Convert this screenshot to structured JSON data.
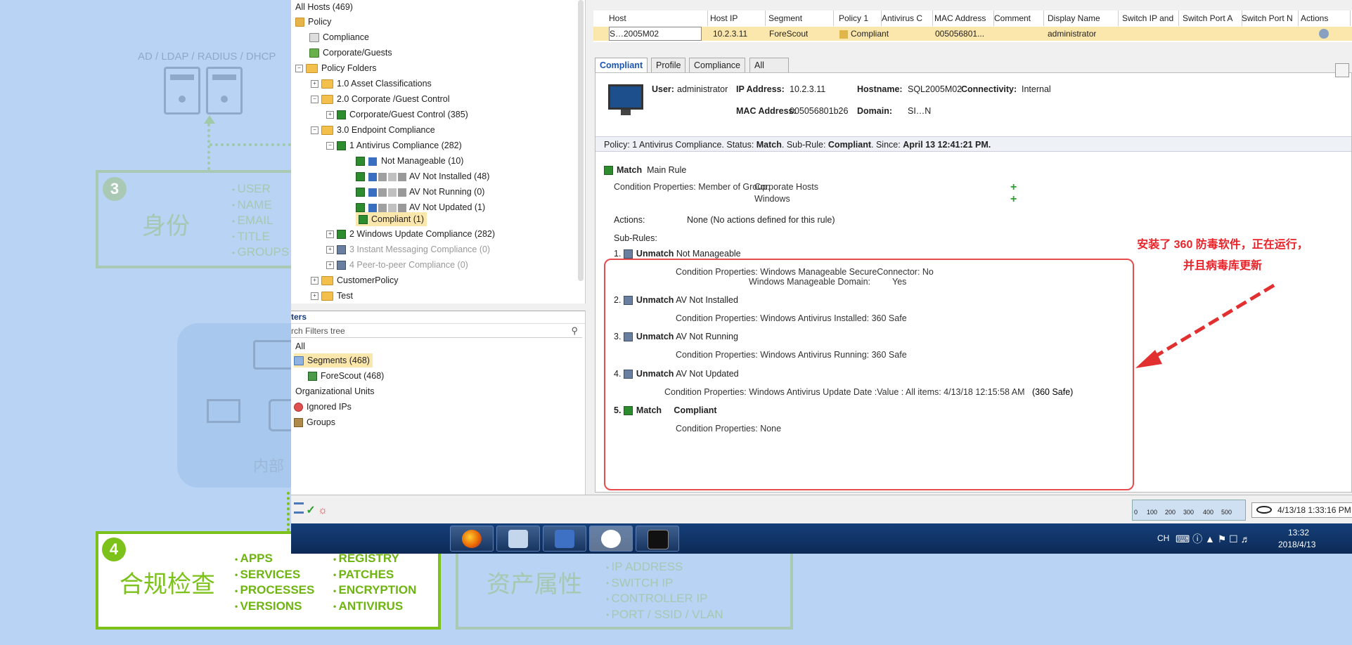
{
  "slide": {
    "ad_label": "AD / LDAP / RADIUS / DHCP",
    "identity": {
      "number": "3",
      "title": "身份",
      "items": [
        "USER",
        "NAME",
        "EMAIL",
        "TITLE",
        "GROUPS"
      ]
    },
    "internal_label": "内部",
    "compliance": {
      "number": "4",
      "title": "合规检查",
      "col1": [
        "APPS",
        "SERVICES",
        "PROCESSES",
        "VERSIONS"
      ],
      "col2": [
        "REGISTRY",
        "PATCHES",
        "ENCRYPTION",
        "ANTIVIRUS"
      ]
    },
    "asset": {
      "title": "资产属性",
      "items": [
        "IP ADDRESS",
        "SWITCH IP",
        "CONTROLLER IP",
        "PORT / SSID / VLAN"
      ]
    }
  },
  "tree": {
    "all_hosts": "All Hosts (469)",
    "policy": "Policy",
    "compliance": "Compliance",
    "corporate_guests": "Corporate/Guests",
    "policy_folders": "Policy Folders",
    "f1": "1.0 Asset Classifications",
    "f2": "2.0 Corporate /Guest Control",
    "f2a": "Corporate/Guest Control (385)",
    "f3": "3.0 Endpoint Compliance",
    "av": "1  Antivirus Compliance (282)",
    "not_manageable": "Not Manageable (10)",
    "not_installed": "AV Not Installed (48)",
    "not_running": "AV Not Running (0)",
    "not_updated": "AV Not Updated (1)",
    "compliant": "Compliant (1)",
    "wu": "2  Windows Update Compliance (282)",
    "im": "3  Instant Messaging Compliance (0)",
    "p2p": "4  Peer-to-peer Compliance (0)",
    "customer": "CustomerPolicy",
    "test": "Test"
  },
  "filters": {
    "header": "ters",
    "search_placeholder": "rch Filters tree",
    "all": "All",
    "segments": "Segments (468)",
    "forescout": "ForeScout (468)",
    "org_units": "Organizational Units",
    "ignored": "Ignored IPs",
    "groups": "Groups"
  },
  "grid": {
    "headers": [
      "Host",
      "Host IP",
      "Segment",
      "Policy 1",
      "Antivirus C",
      "MAC Address",
      "Comment",
      "Display Name",
      "Switch IP and",
      "Switch Port A",
      "Switch Port N",
      "Actions"
    ],
    "row": {
      "host": "S…2005M02",
      "host_ip": "10.2.3.11",
      "segment": "ForeScout",
      "policy": "Compliant",
      "mac": "005056801...",
      "display_name": "administrator"
    }
  },
  "tabs": [
    "Compliant",
    "Profile",
    "Compliance",
    "All policies"
  ],
  "detail": {
    "user_label": "User:",
    "user": "administrator",
    "ip_label": "IP Address:",
    "ip": "10.2.3.11",
    "hostname_label": "Hostname:",
    "hostname": "SQL2005M02",
    "conn_label": "Connectivity:",
    "conn": "Internal",
    "mac_label": "MAC Address:",
    "mac": "005056801b26",
    "domain_label": "Domain:",
    "domain": "SI…N",
    "policy_bar_prefix": "Policy: 1 Antivirus Compliance. Status: ",
    "policy_bar_status": "Match",
    "policy_bar_mid": ". Sub-Rule: ",
    "policy_bar_sub": "Compliant",
    "policy_bar_since": ". Since: ",
    "policy_bar_date": "April 13 12:41:21 PM.",
    "main_match": "Match",
    "main_rule": "Main Rule",
    "cond_label": "Condition Properties: Member of Group:",
    "group1": "Corporate Hosts",
    "group2": "Windows",
    "actions_label": "Actions:",
    "actions_val": "None (No actions defined for this rule)",
    "subrules_label": "Sub-Rules:",
    "sr1_num": "1.",
    "sr1_status": "Unmatch",
    "sr1_name": "Not Manageable",
    "sr1_c1": "Condition Properties: Windows Manageable SecureConnector: No",
    "sr1_c2": "Windows Manageable Domain:",
    "sr1_c2v": "Yes",
    "sr2_num": "2.",
    "sr2_status": "Unmatch",
    "sr2_name": "AV Not Installed",
    "sr2_c": "Condition Properties: Windows Antivirus Installed: 360 Safe",
    "sr3_num": "3.",
    "sr3_status": "Unmatch",
    "sr3_name": "AV Not Running",
    "sr3_c": "Condition Properties: Windows Antivirus Running: 360 Safe",
    "sr4_num": "4.",
    "sr4_status": "Unmatch",
    "sr4_name": "AV Not Updated",
    "sr4_c": "Condition Properties: Windows Antivirus Update Date :Value : All items: 4/13/18 12:15:58 AM",
    "sr4_c_tail": "(360 Safe)",
    "sr5_num": "5.",
    "sr5_status": "Match",
    "sr5_name": "Compliant",
    "sr5_c": "Condition Properties: None"
  },
  "annotation": {
    "line1": "安装了 360 防毒软件，正在运行，",
    "line2": "并且病毒库更新"
  },
  "statusbar": {
    "ruler": [
      "0",
      "100",
      "200",
      "300",
      "400",
      "500"
    ],
    "datetime": "4/13/18 1:33:16 PM"
  },
  "taskbar": {
    "lang": "CH",
    "time": "13:32",
    "date": "2018/4/13"
  }
}
